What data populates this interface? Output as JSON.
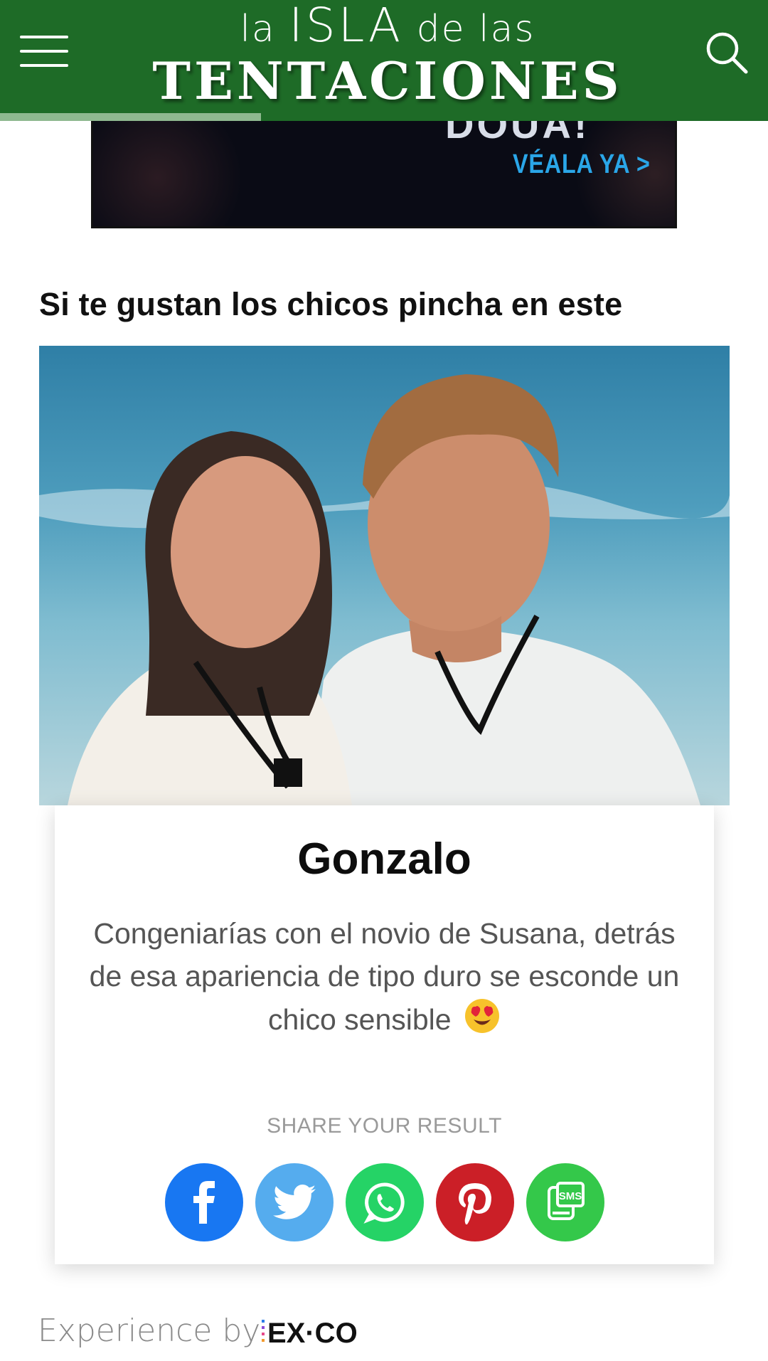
{
  "header": {
    "logo_line1_a": "la",
    "logo_line1_b": "ISLA",
    "logo_line1_c": "de las",
    "logo_line2": "TENTACIONES",
    "menu_icon": "hamburger-menu-icon",
    "search_icon": "search-icon",
    "background_color": "#1e6b27",
    "reading_progress": 0.34
  },
  "ad": {
    "brand_text": "DOUA!",
    "cta": "VÉALA YA  >"
  },
  "section": {
    "title": "Si te gustan los chicos pincha en este"
  },
  "result": {
    "name": "Gonzalo",
    "description": "Congeniarías con el novio de Susana, detrás de esa apariencia de tipo duro se esconde un chico sensible",
    "emoji": "😍"
  },
  "share": {
    "label": "SHARE YOUR RESULT",
    "buttons": [
      {
        "name": "facebook",
        "icon": "facebook-icon",
        "color": "#1877f2"
      },
      {
        "name": "twitter",
        "icon": "twitter-icon",
        "color": "#55acee"
      },
      {
        "name": "whatsapp",
        "icon": "whatsapp-icon",
        "color": "#25d366"
      },
      {
        "name": "pinterest",
        "icon": "pinterest-icon",
        "color": "#cb1f27"
      },
      {
        "name": "sms",
        "icon": "sms-icon",
        "color": "#34c84a"
      }
    ]
  },
  "footer": {
    "text": "Experience by",
    "brand": "EX·CO"
  }
}
